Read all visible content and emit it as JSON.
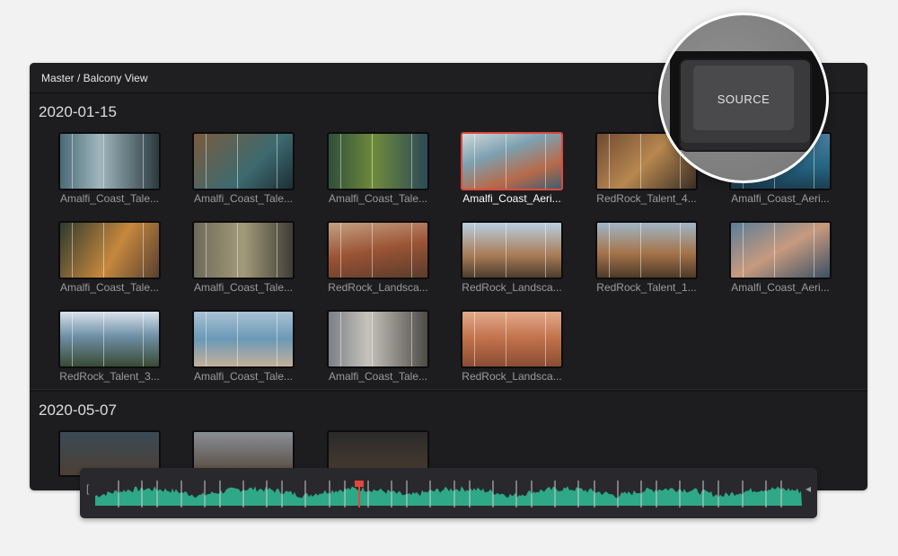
{
  "breadcrumb": "Master / Balcony View",
  "groups": [
    {
      "date": "2020-01-15",
      "clips": [
        {
          "name": "Amalfi_Coast_Tale...",
          "selected": false
        },
        {
          "name": "Amalfi_Coast_Tale...",
          "selected": false
        },
        {
          "name": "Amalfi_Coast_Tale...",
          "selected": false
        },
        {
          "name": "Amalfi_Coast_Aeri...",
          "selected": true
        },
        {
          "name": "RedRock_Talent_4...",
          "selected": false
        },
        {
          "name": "Amalfi_Coast_Aeri...",
          "selected": false
        },
        {
          "name": "Amalfi_Coast_Tale...",
          "selected": false
        },
        {
          "name": "Amalfi_Coast_Tale...",
          "selected": false
        },
        {
          "name": "RedRock_Landsca...",
          "selected": false
        },
        {
          "name": "RedRock_Landsca...",
          "selected": false
        },
        {
          "name": "RedRock_Talent_1...",
          "selected": false
        },
        {
          "name": "Amalfi_Coast_Aeri...",
          "selected": false
        },
        {
          "name": "RedRock_Talent_3...",
          "selected": false
        },
        {
          "name": "Amalfi_Coast_Tale...",
          "selected": false
        },
        {
          "name": "Amalfi_Coast_Tale...",
          "selected": false
        },
        {
          "name": "RedRock_Landsca...",
          "selected": false
        }
      ]
    },
    {
      "date": "2020-05-07",
      "clips": []
    }
  ],
  "keyboard_key": {
    "label": "SOURCE"
  },
  "colors": {
    "selection": "#e0483e",
    "waveform": "#2ea886",
    "playhead": "#e0483e",
    "background": "#1d1d20"
  }
}
